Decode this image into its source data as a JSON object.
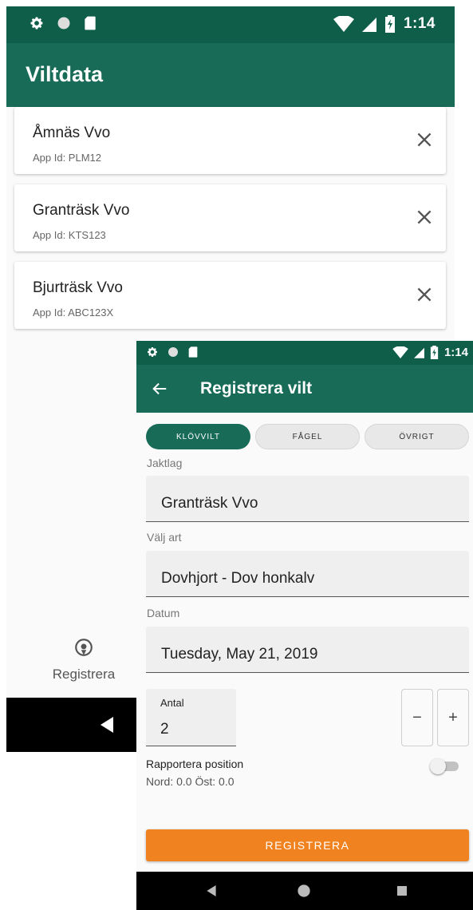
{
  "back_screen": {
    "status_bar": {
      "time": "1:14",
      "left_icons": [
        "gear-icon",
        "circle-icon",
        "sd-card-icon"
      ],
      "right_icons": [
        "wifi-icon",
        "signal-icon",
        "battery-charging-icon"
      ]
    },
    "app_bar": {
      "title": "Viltdata"
    },
    "hunting_teams": [
      {
        "name": "Åmnäs Vvo",
        "app_id": "App Id: PLM12"
      },
      {
        "name": "Granträsk Vvo",
        "app_id": "App Id: KTS123"
      },
      {
        "name": "Bjurträsk Vvo",
        "app_id": "App Id: ABC123X"
      }
    ],
    "bottom_nav": {
      "register_label": "Registrera",
      "icon": "location-pin-icon"
    }
  },
  "front_screen": {
    "status_bar": {
      "time": "1:14"
    },
    "app_bar": {
      "title": "Registrera vilt",
      "back_icon": "arrow-left-icon"
    },
    "category_tabs": [
      {
        "label": "KLÖVVILT",
        "active": true
      },
      {
        "label": "FÅGEL",
        "active": false
      },
      {
        "label": "ÖVRIGT",
        "active": false
      }
    ],
    "form": {
      "jaktlag_label": "Jaktlag",
      "jaktlag_value": "Granträsk Vvo",
      "art_label": "Välj art",
      "art_value": "Dovhjort - Dov honkalv",
      "datum_label": "Datum",
      "datum_value": "Tuesday, May 21, 2019",
      "antal_label": "Antal",
      "antal_value": "2",
      "minus_label": "−",
      "plus_label": "+",
      "position_label": "Rapportera position",
      "position_coords": "Nord: 0.0 Öst: 0.0",
      "position_toggle_on": false
    },
    "submit_label": "REGISTRERA"
  },
  "colors": {
    "status_bar": "#0f5e4a",
    "app_bar": "#176b57",
    "accent_orange": "#f0821f",
    "field_bg": "#efefef"
  }
}
